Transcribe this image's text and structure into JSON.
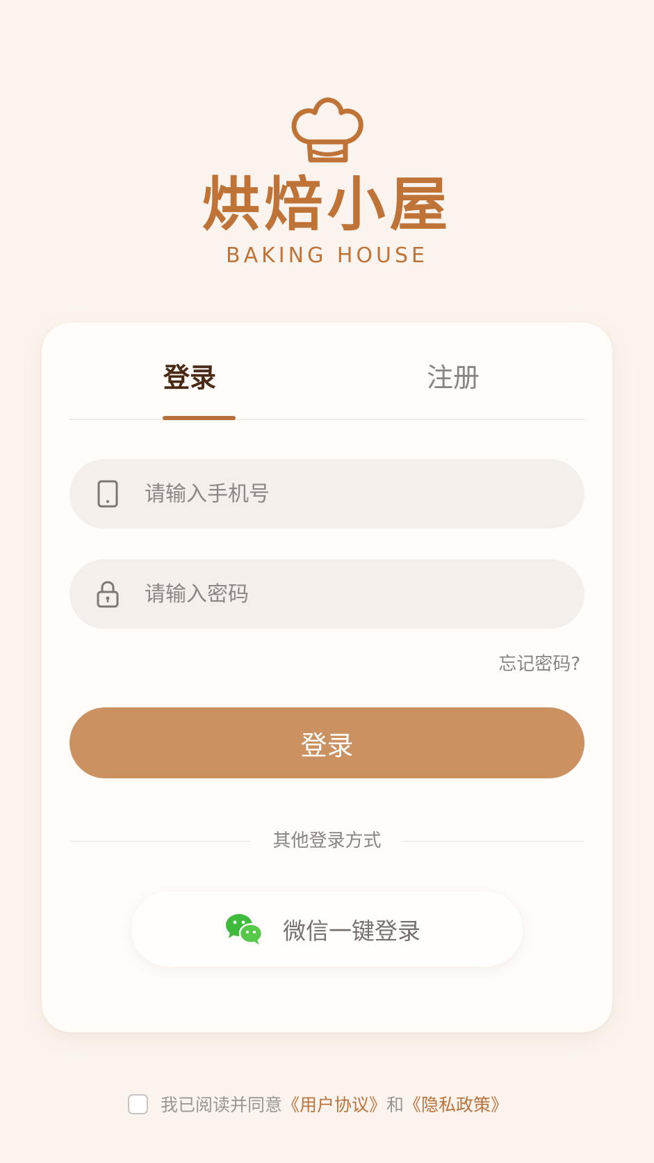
{
  "colors": {
    "background": "#fbf4ee",
    "brand": "#bf7336",
    "primary_button": "#cc9160",
    "link": "#b9733c",
    "wechat_green": "#3fbb3c"
  },
  "brand": {
    "logo_icon": "chef-hat-icon",
    "title": "烘焙小屋",
    "subtitle": "BAKING HOUSE"
  },
  "tabs": {
    "login_label": "登录",
    "register_label": "注册",
    "active": "login"
  },
  "form": {
    "phone": {
      "icon": "phone-icon",
      "placeholder": "请输入手机号",
      "value": ""
    },
    "password": {
      "icon": "lock-icon",
      "placeholder": "请输入密码",
      "value": ""
    },
    "forgot_label": "忘记密码?",
    "submit_label": "登录"
  },
  "other_login": {
    "divider_label": "其他登录方式",
    "wechat_icon": "wechat-icon",
    "wechat_label": "微信一键登录"
  },
  "agreement": {
    "checked": false,
    "prefix": "我已阅读并同意",
    "user_agreement": "《用户协议》",
    "conjunction": "和",
    "privacy_policy": "《隐私政策》"
  }
}
